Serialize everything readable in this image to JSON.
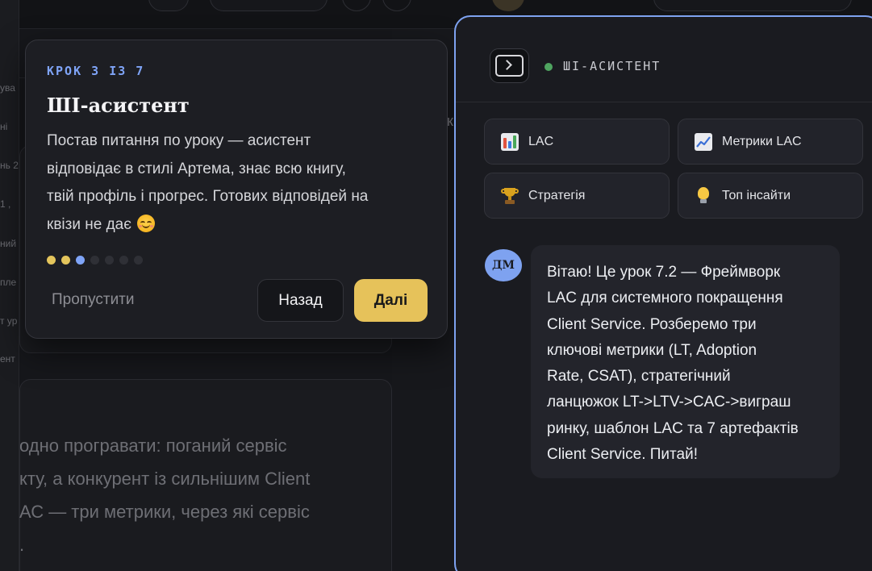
{
  "background": {
    "left_fragments": [
      "ува",
      "ні",
      "нь 2",
      "1 ,",
      "ний",
      "пле",
      "т ур",
      "ент"
    ],
    "card_text_lines": [
      "одно програвати: поганий сервіс",
      "кту, а конкурент із сильнішим Client",
      "АС — три метрики, через які сервіс",
      "."
    ],
    "k_fragment": "к"
  },
  "tour": {
    "step_label": "КРОК 3 ІЗ 7",
    "title": "ШІ-асистент",
    "body_lines": [
      "Постав питання по уроку — асистент",
      "відповідає в стилі Артема, знає всю книгу,",
      "твій профіль і прогрес. Готових відповідей на",
      "квізи не дає"
    ],
    "emoji": "smiling-face-with-blush",
    "steps_total": 7,
    "current_step": 3,
    "skip_label": "Пропустити",
    "back_label": "Назад",
    "next_label": "Далі"
  },
  "assistant": {
    "title": "ШІ-АСИСТЕНТ",
    "status_color": "#4fa560",
    "quick_actions": [
      {
        "label": "LAC",
        "icon": "bar-chart-icon"
      },
      {
        "label": "Метрики LAC",
        "icon": "line-chart-icon"
      },
      {
        "label": "Стратегія",
        "icon": "trophy-icon"
      },
      {
        "label": "Топ інсайти",
        "icon": "lightbulb-icon"
      }
    ],
    "message": {
      "avatar_initials": "ДМ",
      "lines": [
        "Вітаю! Це урок 7.2 — Фреймворк",
        "LAC для системного покращення",
        "Client Service. Розберемо три",
        "ключові метрики (LT, Adoption",
        "Rate, CSAT), стратегічний",
        "ланцюжок LT->LTV->CAC->виграш",
        "ринку, шаблон LAC та 7 артефактів",
        "Client Service. Питай!"
      ]
    }
  },
  "colors": {
    "accent_blue": "#7ea2f0",
    "accent_yellow": "#e6c25a",
    "panel_bg": "#1a1b20"
  }
}
